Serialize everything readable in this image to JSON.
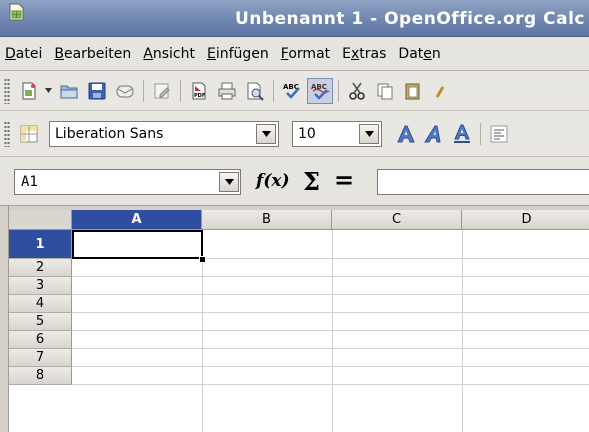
{
  "window": {
    "title": "Unbenannt 1 - OpenOffice.org Calc",
    "icon": "calc-app-icon"
  },
  "menubar": {
    "items": [
      {
        "label": "Datei",
        "mnemonic_index": 0
      },
      {
        "label": "Bearbeiten",
        "mnemonic_index": 0
      },
      {
        "label": "Ansicht",
        "mnemonic_index": 0
      },
      {
        "label": "Einfügen",
        "mnemonic_index": 0
      },
      {
        "label": "Format",
        "mnemonic_index": 0
      },
      {
        "label": "Extras",
        "mnemonic_index": 1
      },
      {
        "label": "Daten",
        "mnemonic_index": 3
      }
    ]
  },
  "standard_toolbar": {
    "icons": [
      "new-document-icon",
      "open-icon",
      "save-icon",
      "email-icon",
      "edit-file-icon",
      "export-pdf-icon",
      "print-icon",
      "page-preview-icon",
      "spellcheck-icon",
      "autospellcheck-icon",
      "cut-icon",
      "copy-icon",
      "paste-icon"
    ]
  },
  "formatting_toolbar": {
    "font_name": "Liberation Sans",
    "font_size": "10",
    "icons": [
      "styles-icon",
      "bold-icon",
      "italic-icon",
      "underline-icon",
      "align-left-icon"
    ]
  },
  "formula_bar": {
    "name_box": "A1",
    "function_wizard": "f(x)",
    "sum_label": "Σ",
    "equals_label": "=",
    "formula": ""
  },
  "sheet": {
    "columns": [
      "A",
      "B",
      "C",
      "D"
    ],
    "rows": [
      "1",
      "2",
      "3",
      "4",
      "5",
      "6",
      "7",
      "8"
    ],
    "selected_cell": "A1",
    "selection_color": "#2f4ea0"
  }
}
